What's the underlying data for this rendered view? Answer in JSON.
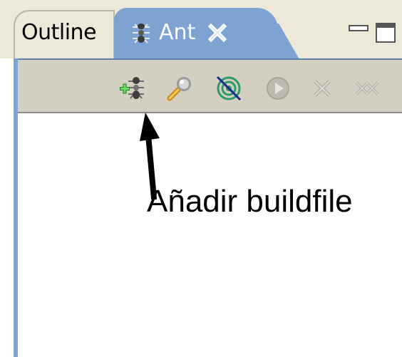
{
  "tabs": [
    {
      "label": "Outline",
      "active": false
    },
    {
      "label": "Ant",
      "active": true
    }
  ],
  "toolbar": {
    "buttons": [
      {
        "icon": "add-buildfile-icon",
        "enabled": true
      },
      {
        "icon": "search-buildfile-icon",
        "enabled": true
      },
      {
        "icon": "hide-internal-targets-icon",
        "enabled": true
      },
      {
        "icon": "run-target-icon",
        "enabled": false
      },
      {
        "icon": "remove-icon",
        "enabled": false
      },
      {
        "icon": "remove-all-icon",
        "enabled": false
      }
    ]
  },
  "annotation": {
    "label": "Añadir buildfile"
  },
  "colors": {
    "active_tab": "#7ea3d2",
    "tab_strip": "#ece9d8",
    "toolbar": "#d3d0c2"
  }
}
